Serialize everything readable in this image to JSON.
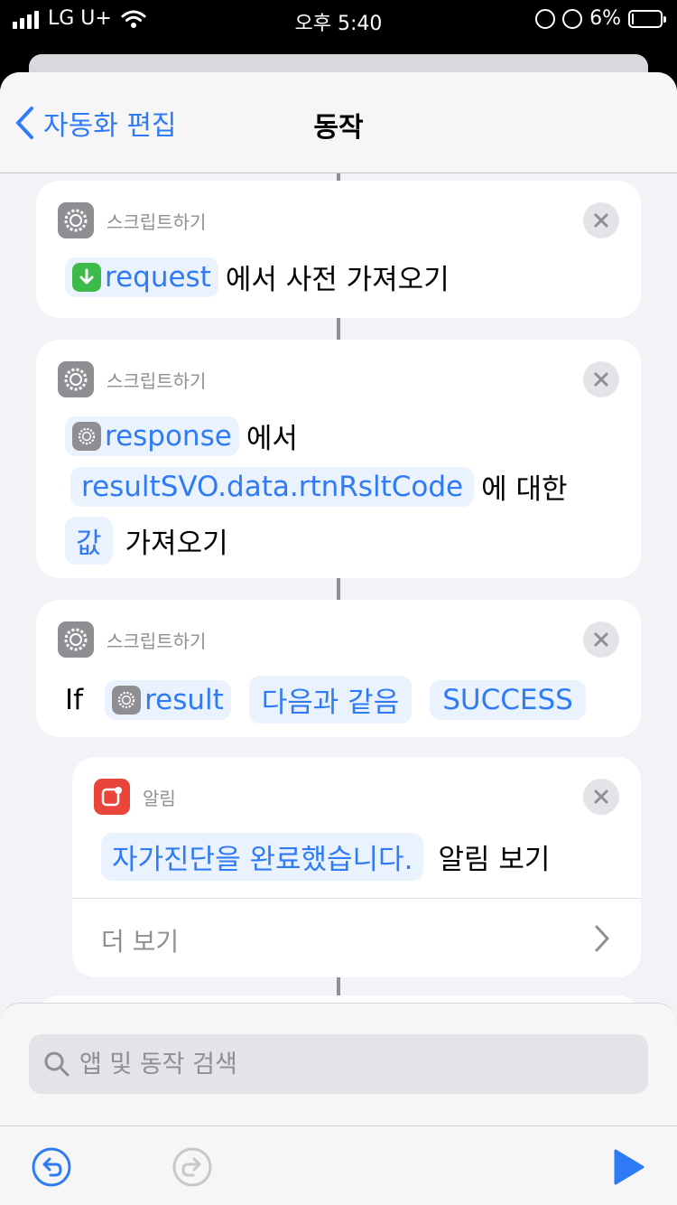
{
  "status_bar": {
    "carrier": "LG U+",
    "time": "오후 5:40",
    "battery_percent": "6%",
    "battery_level": 0.06
  },
  "nav": {
    "back_label": "자동화 편집",
    "title": "동작"
  },
  "actions": [
    {
      "app": "스크립트하기",
      "var": "request",
      "text": "에서 사전 가져오기"
    },
    {
      "app": "스크립트하기",
      "var": "response",
      "text1": "에서",
      "key": "resultSVO.data.rtnRsltCode",
      "text2": "에 대한",
      "type_chip": "값",
      "text3": "가져오기"
    },
    {
      "app": "스크립트하기",
      "if_label": "If",
      "var": "result",
      "condition": "다음과 같음",
      "value": "SUCCESS"
    },
    {
      "app": "알림",
      "message": "자가진단을 완료했습니다.",
      "text": "알림 보기",
      "more_label": "더 보기"
    }
  ],
  "search": {
    "placeholder": "앱 및 동작 검색"
  },
  "colors": {
    "accent": "#2f7bf6",
    "chip_bg": "#eaf2fd",
    "notification_red": "#e9453b",
    "download_green": "#3dbb4a"
  }
}
